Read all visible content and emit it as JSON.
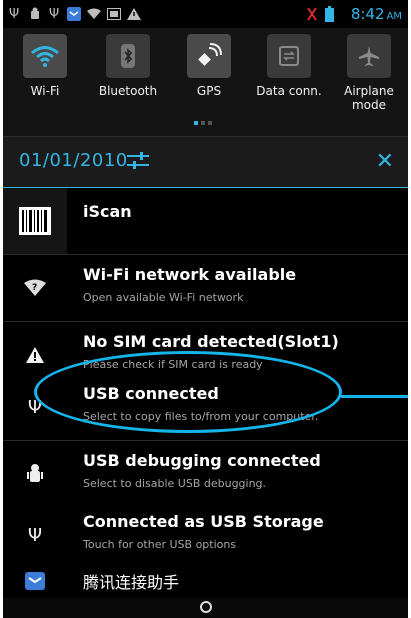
{
  "status_bar": {
    "time": "8:42",
    "ampm": "AM",
    "icons": [
      "usb-icon",
      "android-debug-icon",
      "usb-icon",
      "mail-icon",
      "wifi-icon",
      "image-icon",
      "warning-icon",
      "no-sim-icon",
      "battery-icon"
    ]
  },
  "quick_settings": {
    "tiles": [
      {
        "label": "Wi-Fi",
        "icon": "wifi-icon",
        "active": true
      },
      {
        "label": "Bluetooth",
        "icon": "bluetooth-icon",
        "active": false
      },
      {
        "label": "GPS",
        "icon": "gps-icon",
        "active": true
      },
      {
        "label": "Data conn.",
        "icon": "data-connection-icon",
        "active": false
      },
      {
        "label": "Airplane mode",
        "label_line1": "Airplane",
        "label_line2": "mode",
        "icon": "airplane-icon",
        "active": false
      }
    ]
  },
  "date_bar": {
    "date": "01/01/2010"
  },
  "notifications": [
    {
      "title": "iScan",
      "subtitle": "",
      "icon": "barcode-icon"
    },
    {
      "title": "Wi-Fi network available",
      "subtitle": "Open available Wi-Fi network",
      "icon": "wifi-question-icon"
    },
    {
      "title": "No SIM card detected(Slot1)",
      "subtitle": "Please check if SIM card is ready",
      "icon": "warning-icon"
    },
    {
      "title": "USB connected",
      "subtitle": "Select to copy files to/from your computer.",
      "icon": "usb-icon"
    },
    {
      "title": "USB debugging connected",
      "subtitle": "Select to disable USB debugging.",
      "icon": "android-debug-icon"
    },
    {
      "title": "Connected as USB Storage",
      "subtitle": "Touch for other USB options",
      "icon": "usb-icon"
    },
    {
      "title": "腾讯连接助手",
      "subtitle": "",
      "icon": "mail-icon"
    }
  ],
  "colors": {
    "accent": "#33b5e5",
    "highlight": "#15b5ea",
    "background": "#000000"
  }
}
